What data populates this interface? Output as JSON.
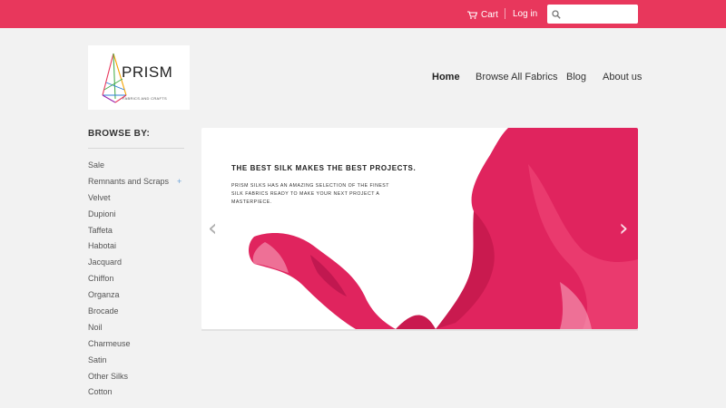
{
  "header": {
    "cart_label": "Cart",
    "login_label": "Log in",
    "search_placeholder": "",
    "accent_color": "#e8375c"
  },
  "logo": {
    "wordmark": "PRISM",
    "tagline": "FABRICS AND CRAFTS"
  },
  "nav": {
    "items": [
      {
        "label": "Home",
        "active": true
      },
      {
        "label": "Browse All Fabrics",
        "active": false
      },
      {
        "label": "Blog",
        "active": false
      },
      {
        "label": "About us",
        "active": false
      }
    ]
  },
  "sidebar": {
    "title": "BROWSE BY:",
    "items": [
      {
        "label": "Sale"
      },
      {
        "label": "Remnants and Scraps",
        "expand": "+"
      },
      {
        "label": "Velvet"
      },
      {
        "label": "Dupioni"
      },
      {
        "label": "Taffeta"
      },
      {
        "label": "Habotai"
      },
      {
        "label": "Jacquard"
      },
      {
        "label": "Chiffon"
      },
      {
        "label": "Organza"
      },
      {
        "label": "Brocade"
      },
      {
        "label": "Noil"
      },
      {
        "label": "Charmeuse"
      },
      {
        "label": "Satin"
      },
      {
        "label": "Other Silks"
      },
      {
        "label": "Cotton"
      }
    ]
  },
  "hero": {
    "headline": "THE BEST SILK MAKES THE BEST PROJECTS.",
    "body": "PRISM SILKS HAS AN AMAZING SELECTION OF THE FINEST SILK FABRICS READY TO MAKE YOUR NEXT PROJECT A MASTERPIECE.",
    "prev_arrow": "‹",
    "next_arrow": "›",
    "silk_color": "#e0245e"
  }
}
